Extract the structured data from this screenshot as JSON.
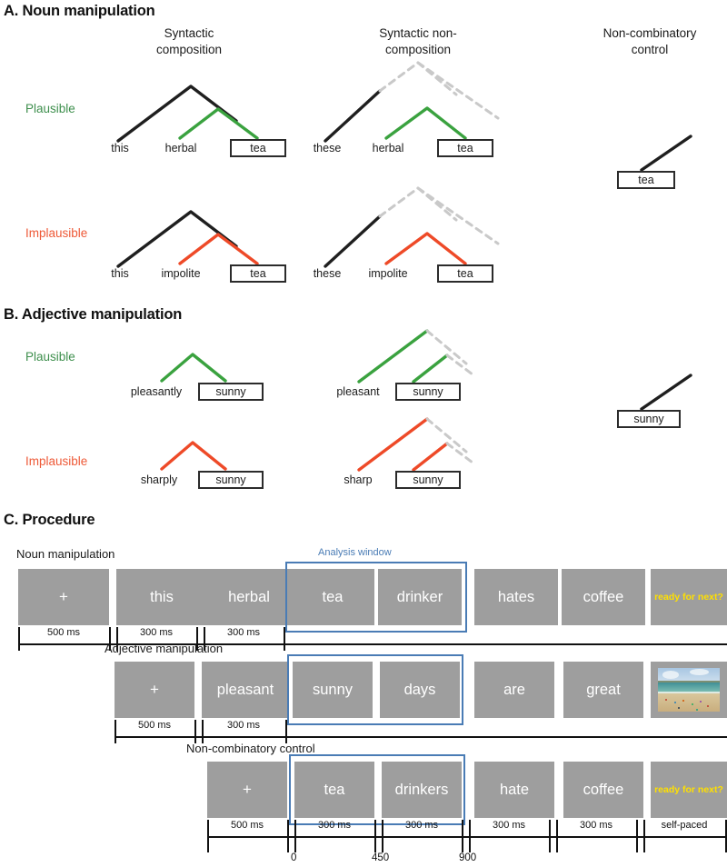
{
  "figure": {
    "panels": [
      {
        "id": "A",
        "title": "A. Noun manipulation"
      },
      {
        "id": "B",
        "title": "B. Adjective manipulation"
      },
      {
        "id": "C",
        "title": "C. Procedure"
      }
    ]
  },
  "columns": {
    "syntactic_composition": "Syntactic\ncomposition",
    "syntactic_composition_l1": "Syntactic",
    "syntactic_composition_l2": "composition",
    "syntactic_noncomposition_l1": "Syntactic non-",
    "syntactic_noncomposition_l2": "composition",
    "noncombinatory_control_l1": "Non-combinatory",
    "noncombinatory_control_l2": "control"
  },
  "conditions": {
    "plausible": "Plausible",
    "implausible": "Implausible"
  },
  "panelA": {
    "plausible": {
      "composition": {
        "w1": "this",
        "w2": "herbal",
        "w3": "tea"
      },
      "noncomposition": {
        "w1": "these",
        "w2": "herbal",
        "w3": "tea"
      },
      "control": {
        "w1": "tea"
      }
    },
    "implausible": {
      "composition": {
        "w1": "this",
        "w2": "impolite",
        "w3": "tea"
      },
      "noncomposition": {
        "w1": "these",
        "w2": "impolite",
        "w3": "tea"
      },
      "control": {
        "w1": "tea"
      }
    }
  },
  "panelB": {
    "plausible": {
      "composition": {
        "w1": "pleasantly",
        "w2": "sunny"
      },
      "noncomposition": {
        "w1": "pleasant",
        "w2": "sunny"
      },
      "control": {
        "w1": "sunny"
      }
    },
    "implausible": {
      "composition": {
        "w1": "sharply",
        "w2": "sunny"
      },
      "noncomposition": {
        "w1": "sharp",
        "w2": "sunny"
      },
      "control": {
        "w1": "sunny"
      }
    }
  },
  "panelC": {
    "analysis_window_label": "Analysis window",
    "rows": [
      {
        "name": "Noun manipulation",
        "stimuli": [
          "+",
          "this",
          "herbal",
          "tea",
          "drinker",
          "hates",
          "coffee",
          "ready for next?"
        ],
        "kinds": [
          "fix",
          "word",
          "word",
          "word",
          "word",
          "word",
          "word",
          "ready"
        ],
        "durations": [
          "500 ms",
          "300 ms",
          "300 ms"
        ]
      },
      {
        "name": "Adjective manipulation",
        "stimuli": [
          "+",
          "pleasant",
          "sunny",
          "days",
          "are",
          "great",
          "beach-photo"
        ],
        "kinds": [
          "fix",
          "word",
          "word",
          "word",
          "word",
          "word",
          "pic"
        ],
        "durations": [
          "500 ms",
          "300 ms"
        ]
      },
      {
        "name": "Non-combinatory control",
        "stimuli": [
          "+",
          "tea",
          "drinkers",
          "hate",
          "coffee",
          "ready for next?"
        ],
        "kinds": [
          "fix",
          "word",
          "word",
          "word",
          "word",
          "ready"
        ],
        "durations": [
          "500 ms",
          "300 ms",
          "300 ms",
          "300 ms",
          "300 ms",
          "self-paced"
        ]
      }
    ],
    "time_ticks": [
      "0",
      "450",
      "900"
    ]
  },
  "colors": {
    "green": "#3aa23f",
    "red": "#ee4a28",
    "black": "#1f1f1f",
    "gray_dashed": "#c9c9c9",
    "blue": "#4a7cb5",
    "stim_gray": "#9e9e9e",
    "ready_yellow": "#ffe000"
  }
}
